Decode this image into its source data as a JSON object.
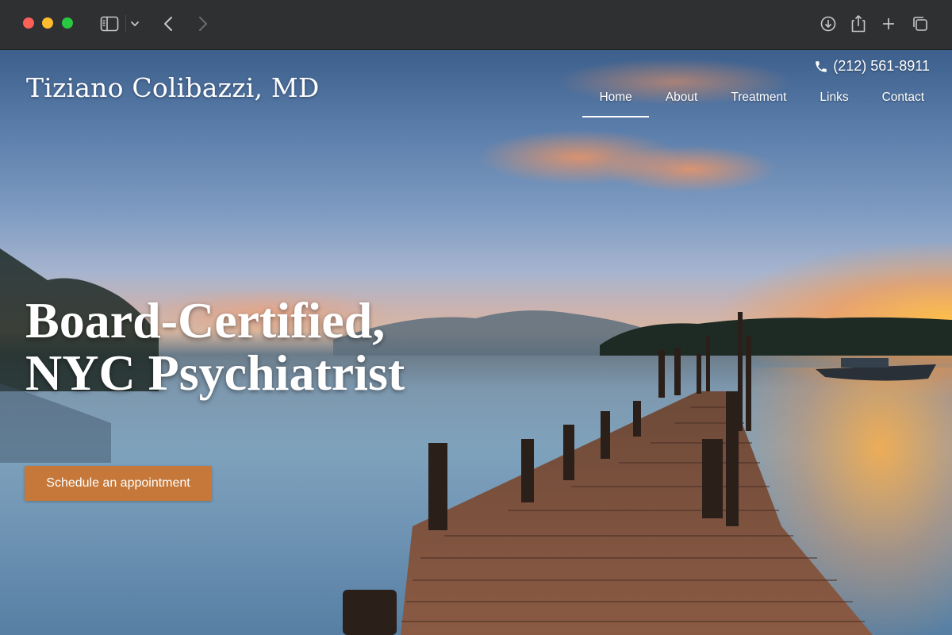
{
  "browser": {
    "icons": [
      "sidebar-icon",
      "chevron-down-icon",
      "back-icon",
      "forward-icon",
      "download-icon",
      "share-icon",
      "plus-icon",
      "tabs-icon"
    ]
  },
  "site": {
    "logo": "Tiziano Colibazzi, MD",
    "phone": "(212) 561-8911",
    "nav": [
      {
        "label": "Home",
        "active": true
      },
      {
        "label": "About",
        "active": false
      },
      {
        "label": "Treatment",
        "active": false
      },
      {
        "label": "Links",
        "active": false
      },
      {
        "label": "Contact",
        "active": false
      }
    ],
    "headline_line1": "Board-Certified,",
    "headline_line2": "NYC Psychiatrist",
    "cta_label": "Schedule an appointment"
  },
  "colors": {
    "cta": "#c5783a",
    "chrome": "#2f3032",
    "text": "#ffffff"
  }
}
